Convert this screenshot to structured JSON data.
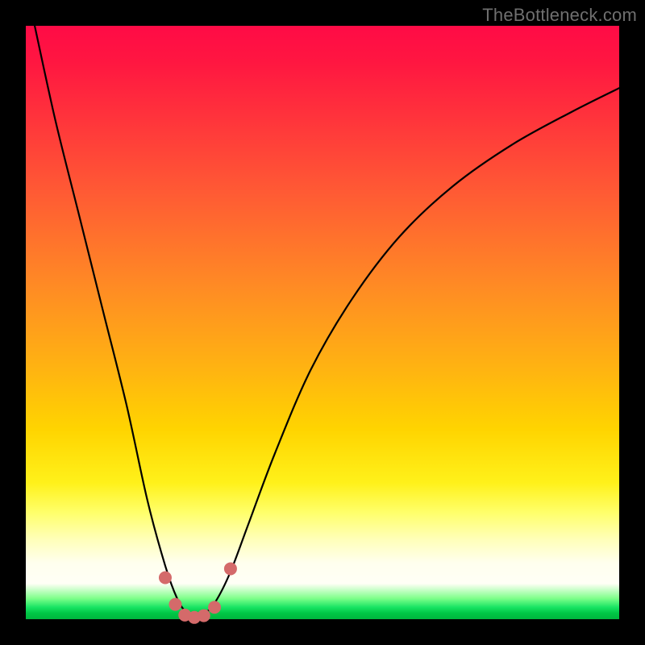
{
  "watermark": "TheBottleneck.com",
  "colors": {
    "black": "#000000",
    "curve": "#000000",
    "markerFill": "#d46a6a",
    "markerStroke": "#b34f4f"
  },
  "chart_data": {
    "type": "line",
    "title": "",
    "xlabel": "",
    "ylabel": "",
    "xlim": [
      0,
      1
    ],
    "ylim": [
      0,
      1
    ],
    "note": "Axes carry no tick labels in the source image; values below are normalized [0,1] estimates read off the pixels. y=1 is the top of the plot (max bottleneck), y≈0 is the green optimum band at the bottom.",
    "series": [
      {
        "name": "bottleneck-curve",
        "x": [
          0.015,
          0.05,
          0.09,
          0.13,
          0.17,
          0.205,
          0.235,
          0.255,
          0.27,
          0.285,
          0.3,
          0.32,
          0.345,
          0.375,
          0.42,
          0.48,
          0.55,
          0.63,
          0.72,
          0.82,
          0.92,
          1.0
        ],
        "y": [
          1.0,
          0.84,
          0.68,
          0.52,
          0.36,
          0.2,
          0.09,
          0.035,
          0.012,
          0.004,
          0.008,
          0.03,
          0.08,
          0.16,
          0.28,
          0.42,
          0.54,
          0.645,
          0.73,
          0.8,
          0.855,
          0.895
        ]
      }
    ],
    "markers": {
      "name": "highlighted-points",
      "x": [
        0.235,
        0.252,
        0.268,
        0.284,
        0.3,
        0.318,
        0.345
      ],
      "y": [
        0.07,
        0.025,
        0.007,
        0.003,
        0.006,
        0.02,
        0.085
      ]
    }
  }
}
